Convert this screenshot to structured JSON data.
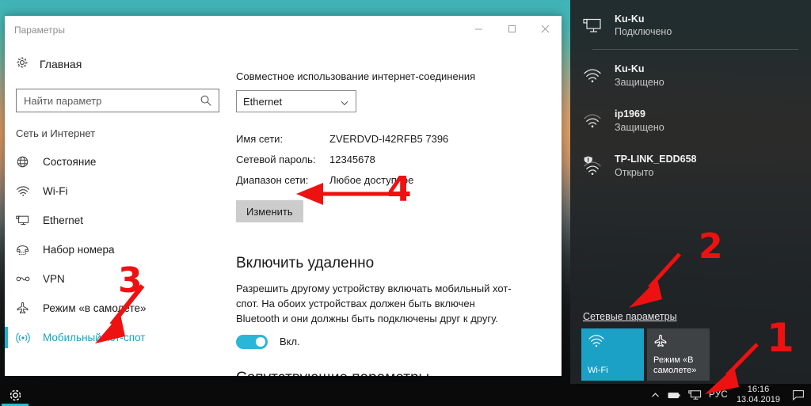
{
  "window": {
    "title": "Параметры",
    "minimize_icon": "minimize-icon",
    "maximize_icon": "maximize-icon",
    "close_icon": "close-icon"
  },
  "sidebar": {
    "home_label": "Главная",
    "home_icon": "gear-icon",
    "search": {
      "placeholder": "Найти параметр",
      "value": "",
      "icon": "search-icon"
    },
    "section_title": "Сеть и Интернет",
    "items": [
      {
        "label": "Состояние",
        "icon": "globe-icon",
        "active": false
      },
      {
        "label": "Wi-Fi",
        "icon": "wifi-icon",
        "active": false
      },
      {
        "label": "Ethernet",
        "icon": "ethernet-icon",
        "active": false
      },
      {
        "label": "Набор номера",
        "icon": "dialup-icon",
        "active": false
      },
      {
        "label": "VPN",
        "icon": "vpn-icon",
        "active": false
      },
      {
        "label": "Режим «в самолете»",
        "icon": "airplane-icon",
        "active": false
      },
      {
        "label": "Мобильный хот-спот",
        "icon": "hotspot-icon",
        "active": true
      }
    ],
    "accent_color": "#19b6d6"
  },
  "main": {
    "share_label": "Совместное использование интернет-соединения",
    "share_value": "Ethernet",
    "share_chevron": "chevron-down-icon",
    "info": [
      {
        "key": "Имя сети:",
        "value": "ZVERDVD-I42RFB5 7396"
      },
      {
        "key": "Сетевой пароль:",
        "value": "12345678"
      },
      {
        "key": "Диапазон сети:",
        "value": "Любое доступное"
      }
    ],
    "edit_button": "Изменить",
    "remote_heading": "Включить удаленно",
    "remote_description": "Разрешить другому устройству включать мобильный хот-спот. На обоих устройствах должен быть включен Bluetooth и они должны быть подключены друг к другу.",
    "toggle_state": "Вкл.",
    "toggle_color": "#29b6d8",
    "related_heading": "Сопутствующие параметры"
  },
  "network_flyout": {
    "connected": {
      "name": "Ku-Ku",
      "status": "Подключено",
      "icon": "ethernet-icon"
    },
    "networks": [
      {
        "name": "Ku-Ku",
        "status": "Защищено",
        "icon": "wifi-icon",
        "bars": 3
      },
      {
        "name": "ip1969",
        "status": "Защищено",
        "icon": "wifi-icon",
        "bars": 2
      },
      {
        "name": "TP-LINK_EDD658",
        "status": "Открыто",
        "icon": "wifi-warning-icon",
        "bars": 2
      }
    ],
    "settings_link": "Сетевые параметры",
    "tiles": [
      {
        "label": "Wi-Fi",
        "icon": "wifi-icon",
        "state": "on",
        "color": "#1ba1c5"
      },
      {
        "label": "Режим «В самолете»",
        "icon": "airplane-icon",
        "state": "off",
        "color": "#3e4244"
      }
    ]
  },
  "taskbar": {
    "start_icon": "gear-icon",
    "tray": [
      {
        "icon": "chevron-up-icon",
        "name": "show-hidden-icons"
      },
      {
        "icon": "battery-icon",
        "name": "battery"
      },
      {
        "icon": "network-icon",
        "name": "network"
      }
    ],
    "language": "РУС",
    "time": "16:16",
    "date": "13.04.2019",
    "notification_icon": "notification-icon"
  },
  "annotations": {
    "color": "#ee1111",
    "markers": [
      {
        "number": "1",
        "target": "taskbar-network-icon"
      },
      {
        "number": "2",
        "target": "net-settings-link"
      },
      {
        "number": "3",
        "target": "sidebar-item-mobile-hotspot"
      },
      {
        "number": "4",
        "target": "edit-button"
      }
    ]
  }
}
